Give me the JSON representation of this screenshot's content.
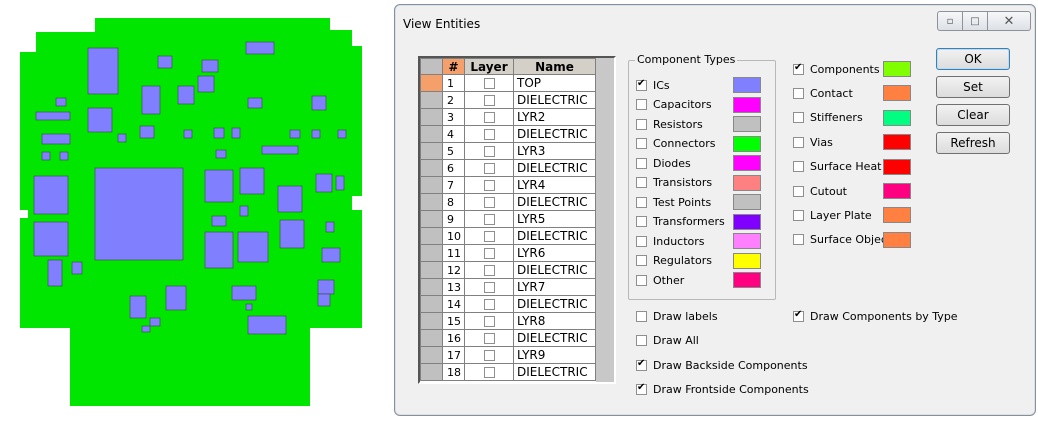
{
  "window": {
    "title": "View Entities",
    "minimize_icon": "minimize-icon",
    "maximize_icon": "maximize-icon",
    "close_icon": "close-icon"
  },
  "grid": {
    "headers": {
      "num": "#",
      "layer": "Layer",
      "name": "Name"
    },
    "rows": [
      {
        "num": "1",
        "name": "TOP",
        "active": true
      },
      {
        "num": "2",
        "name": "DIELECTRIC"
      },
      {
        "num": "3",
        "name": "LYR2"
      },
      {
        "num": "4",
        "name": "DIELECTRIC"
      },
      {
        "num": "5",
        "name": "LYR3"
      },
      {
        "num": "6",
        "name": "DIELECTRIC"
      },
      {
        "num": "7",
        "name": "LYR4"
      },
      {
        "num": "8",
        "name": "DIELECTRIC"
      },
      {
        "num": "9",
        "name": "LYR5"
      },
      {
        "num": "10",
        "name": "DIELECTRIC"
      },
      {
        "num": "11",
        "name": "LYR6"
      },
      {
        "num": "12",
        "name": "DIELECTRIC"
      },
      {
        "num": "13",
        "name": "LYR7"
      },
      {
        "num": "14",
        "name": "DIELECTRIC"
      },
      {
        "num": "15",
        "name": "LYR8"
      },
      {
        "num": "16",
        "name": "DIELECTRIC"
      },
      {
        "num": "17",
        "name": "LYR9"
      },
      {
        "num": "18",
        "name": "DIELECTRIC"
      }
    ]
  },
  "component_types": {
    "title": "Component Types",
    "items": [
      {
        "label": "ICs",
        "checked": true,
        "color": "#8080ff"
      },
      {
        "label": "Capacitors",
        "checked": false,
        "color": "#ff00ff"
      },
      {
        "label": "Resistors",
        "checked": false,
        "color": "#c0c0c0"
      },
      {
        "label": "Connectors",
        "checked": false,
        "color": "#00ff00"
      },
      {
        "label": "Diodes",
        "checked": false,
        "color": "#ff00ff"
      },
      {
        "label": "Transistors",
        "checked": false,
        "color": "#ff8080"
      },
      {
        "label": "Test Points",
        "checked": false,
        "color": "#c0c0c0"
      },
      {
        "label": "Transformers",
        "checked": false,
        "color": "#8000ff"
      },
      {
        "label": "Inductors",
        "checked": false,
        "color": "#ff80ff"
      },
      {
        "label": "Regulators",
        "checked": false,
        "color": "#ffff00"
      },
      {
        "label": "Other",
        "checked": false,
        "color": "#ff0080"
      }
    ]
  },
  "entities": {
    "items": [
      {
        "label": "Components",
        "checked": true,
        "color": "#80ff00"
      },
      {
        "label": "Contact",
        "checked": false,
        "color": "#ff8040"
      },
      {
        "label": "Stiffeners",
        "checked": false,
        "color": "#00ff80"
      },
      {
        "label": "Vias",
        "checked": false,
        "color": "#ff0000"
      },
      {
        "label": "Surface Heat",
        "checked": false,
        "color": "#ff0000"
      },
      {
        "label": "Cutout",
        "checked": false,
        "color": "#ff0080"
      },
      {
        "label": "Layer Plate",
        "checked": false,
        "color": "#ff8040"
      },
      {
        "label": "Surface Object",
        "checked": false,
        "color": "#ff8040"
      }
    ]
  },
  "options": {
    "draw_labels": {
      "label": "Draw labels",
      "checked": false
    },
    "draw_all": {
      "label": "Draw All",
      "checked": false
    },
    "draw_backside": {
      "label": "Draw Backside Components",
      "checked": true
    },
    "draw_frontside": {
      "label": "Draw Frontside Components",
      "checked": true
    },
    "draw_by_type": {
      "label": "Draw Components by Type",
      "checked": true
    }
  },
  "buttons": {
    "ok": "OK",
    "set": "Set",
    "clear": "Clear",
    "refresh": "Refresh"
  },
  "board": {
    "board_color": "#00e600",
    "ic_color": "#8080ff"
  }
}
